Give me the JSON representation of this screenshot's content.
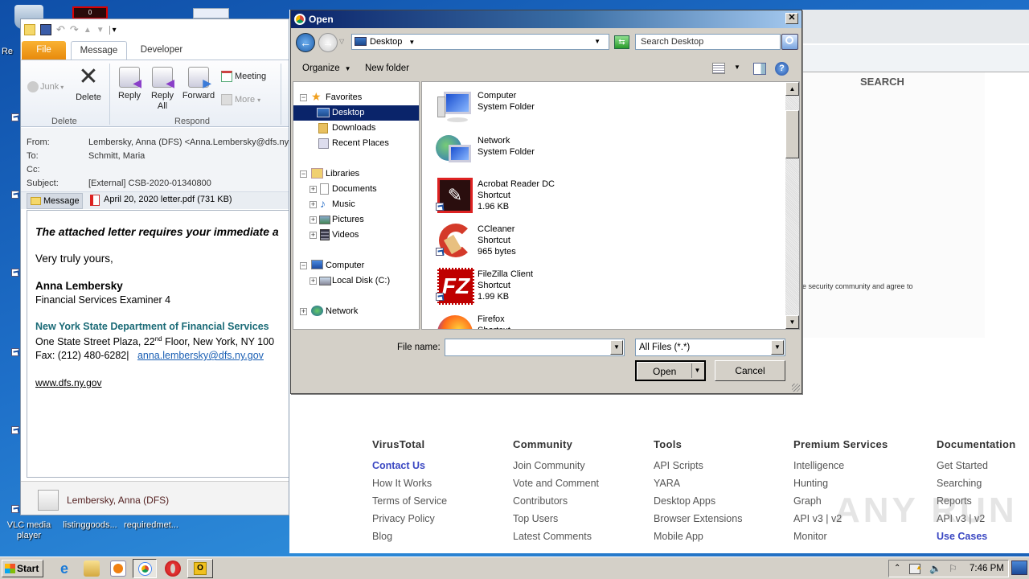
{
  "desktop": {
    "icons": [
      {
        "label": "Re",
        "name": "recycle-bin"
      },
      {
        "label": "VLC media player",
        "name": "vlc"
      },
      {
        "label": "listinggoods...",
        "name": "file-listinggoods"
      },
      {
        "label": "requiredmet...",
        "name": "file-requiredmet"
      }
    ],
    "badge_value": "0"
  },
  "outlook": {
    "tabs": {
      "file": "File",
      "message": "Message",
      "developer": "Developer"
    },
    "ribbon": {
      "junk": "Junk",
      "delete": "Delete",
      "reply": "Reply",
      "reply_all_1": "Reply",
      "reply_all_2": "All",
      "forward": "Forward",
      "meeting": "Meeting",
      "more": "More",
      "group_delete": "Delete",
      "group_respond": "Respond"
    },
    "header": {
      "from_label": "From:",
      "from_value": "Lembersky, Anna (DFS) <Anna.Lembersky@dfs.ny.gov>",
      "to_label": "To:",
      "to_value": "Schmitt, Maria",
      "cc_label": "Cc:",
      "cc_value": "",
      "subject_label": "Subject:",
      "subject_value": "[External] CSB-2020-01340800"
    },
    "attachments": {
      "message_tab": "Message",
      "pdf": "April 20, 2020 letter.pdf (731 KB)"
    },
    "body": {
      "lead": "The attached letter requires your immediate a",
      "closing": "Very truly yours,",
      "sig_name": "Anna Lembersky",
      "sig_title": "Financial Services Examiner 4",
      "org": "New York State Department of Financial Services",
      "address_pre": "One State Street Plaza, 22",
      "address_sup": "nd",
      "address_post": " Floor, New York, NY 100",
      "fax": "Fax: (212) 480-6282|",
      "email": "anna.lembersky@dfs.ny.gov",
      "website": "www.dfs.ny.gov"
    },
    "people_pane": {
      "name": "Lembersky, Anna (DFS)"
    }
  },
  "dialog": {
    "title": "Open",
    "address": "Desktop",
    "search_placeholder": "Search Desktop",
    "toolbar": {
      "organize": "Organize",
      "new_folder": "New folder"
    },
    "nav": [
      {
        "label": "Favorites",
        "level": 0,
        "expander": "−"
      },
      {
        "label": "Desktop",
        "level": 1,
        "selected": true
      },
      {
        "label": "Downloads",
        "level": 1
      },
      {
        "label": "Recent Places",
        "level": 1
      },
      {
        "label": "Libraries",
        "level": 0,
        "expander": "−"
      },
      {
        "label": "Documents",
        "level": 1,
        "expander": "+"
      },
      {
        "label": "Music",
        "level": 1,
        "expander": "+"
      },
      {
        "label": "Pictures",
        "level": 1,
        "expander": "+"
      },
      {
        "label": "Videos",
        "level": 1,
        "expander": "+"
      },
      {
        "label": "Computer",
        "level": 0,
        "expander": "−"
      },
      {
        "label": "Local Disk (C:)",
        "level": 1,
        "expander": "+"
      },
      {
        "label": "Network",
        "level": 0,
        "expander": "+"
      }
    ],
    "files": [
      {
        "name": "Computer",
        "type": "System Folder",
        "size": ""
      },
      {
        "name": "Network",
        "type": "System Folder",
        "size": ""
      },
      {
        "name": "Acrobat Reader DC",
        "type": "Shortcut",
        "size": "1.96 KB"
      },
      {
        "name": "CCleaner",
        "type": "Shortcut",
        "size": "965 bytes"
      },
      {
        "name": "FileZilla Client",
        "type": "Shortcut",
        "size": "1.99 KB"
      },
      {
        "name": "Firefox",
        "type": "Shortcut",
        "size": ""
      }
    ],
    "file_name_label": "File name:",
    "file_name_value": "",
    "file_type": "All Files (*.*)",
    "open_button": "Open",
    "cancel_button": "Cancel"
  },
  "browser": {
    "search_heading": "SEARCH",
    "agree_text": "e security community and agree to",
    "footer": [
      {
        "heading": "VirusTotal",
        "links": [
          "Contact Us",
          "How It Works",
          "Terms of Service",
          "Privacy Policy",
          "Blog"
        ],
        "highlight": 0
      },
      {
        "heading": "Community",
        "links": [
          "Join Community",
          "Vote and Comment",
          "Contributors",
          "Top Users",
          "Latest Comments"
        ],
        "highlight": -1
      },
      {
        "heading": "Tools",
        "links": [
          "API Scripts",
          "YARA",
          "Desktop Apps",
          "Browser Extensions",
          "Mobile App"
        ],
        "highlight": -1
      },
      {
        "heading": "Premium Services",
        "links": [
          "Intelligence",
          "Hunting",
          "Graph",
          "API v3 | v2",
          "Monitor"
        ],
        "highlight": -1
      },
      {
        "heading": "Documentation",
        "links": [
          "Get Started",
          "Searching",
          "Reports",
          "API v3 | v2",
          "Use Cases"
        ],
        "highlight": 4
      }
    ],
    "watermark": "ANY RUN"
  },
  "taskbar": {
    "start": "Start",
    "clock": "7:46 PM"
  }
}
